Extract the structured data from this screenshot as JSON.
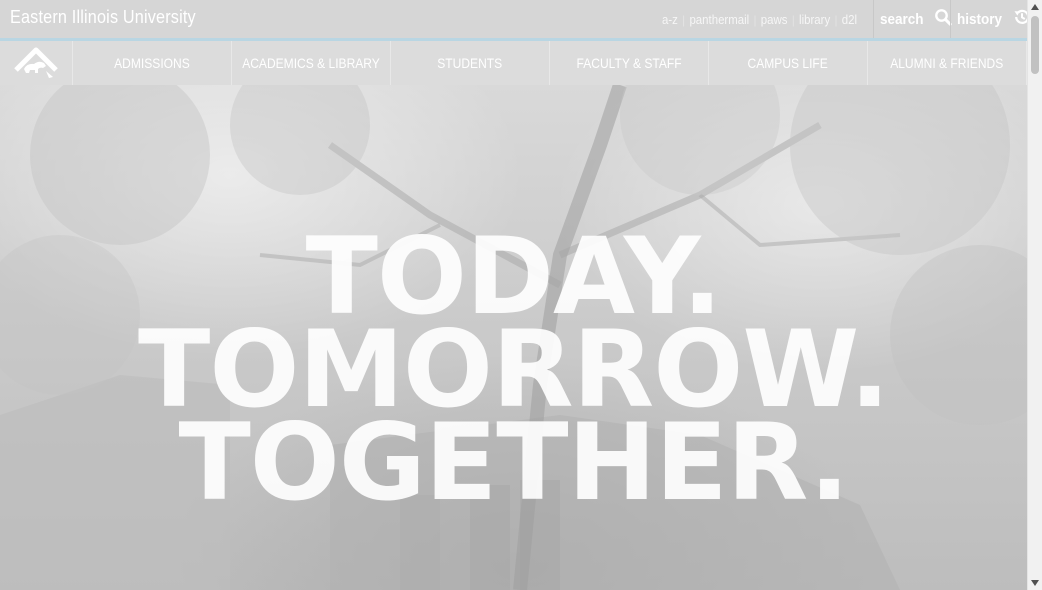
{
  "header": {
    "site_title": "Eastern Illinois University",
    "quicklinks": [
      {
        "label": "a-z"
      },
      {
        "label": "panthermail"
      },
      {
        "label": "paws"
      },
      {
        "label": "library"
      },
      {
        "label": "d2l"
      }
    ],
    "separator": "|",
    "search": {
      "label": "search",
      "icon": "search-icon"
    },
    "history": {
      "label": "history",
      "icon": "history-icon"
    }
  },
  "nav": {
    "home_icon": "home-panther-icon",
    "items": [
      {
        "label": "ADMISSIONS"
      },
      {
        "label": "ACADEMICS & LIBRARY"
      },
      {
        "label": "STUDENTS"
      },
      {
        "label": "FACULTY & STAFF"
      },
      {
        "label": "CAMPUS LIFE"
      },
      {
        "label": "ALUMNI & FRIENDS"
      }
    ]
  },
  "hero": {
    "lines": [
      "TODAY.",
      "TOMORROW.",
      "TOGETHER."
    ]
  },
  "colors": {
    "accent_underline": "#b9d6e3",
    "header_bg": "#d6d6d6",
    "nav_bg": "#dcdcdc",
    "text_light": "#ffffff"
  }
}
